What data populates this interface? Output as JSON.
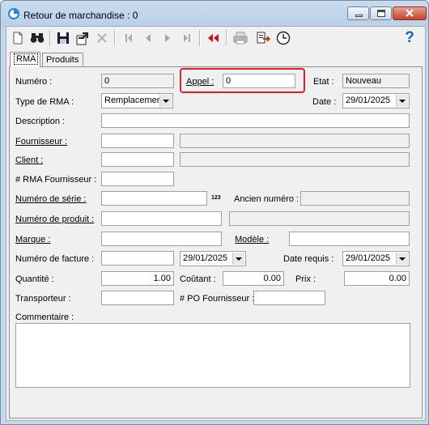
{
  "window": {
    "title": "Retour de marchandise : 0",
    "help_label": "?"
  },
  "toolbar": {
    "icons": [
      "new-document-icon",
      "binoculars-search-icon",
      "save-icon",
      "export-icon",
      "delete-icon",
      "first-record-icon",
      "previous-record-icon",
      "next-record-icon",
      "last-record-icon",
      "rewind-icon",
      "print-icon",
      "transfer-icon",
      "clock-icon"
    ]
  },
  "tabs": [
    "RMA",
    "Produits"
  ],
  "form": {
    "numero_label": "Numéro :",
    "numero_value": "0",
    "appel_label": "Appel :",
    "appel_value": "0",
    "etat_label": "Etat :",
    "etat_value": "Nouveau",
    "type_label": "Type de RMA :",
    "type_value": "Remplacement",
    "date_label": "Date :",
    "date_value": "29/01/2025",
    "description_label": "Description :",
    "fournisseur_label": "Fournisseur :",
    "client_label": "Client :",
    "rma_fournisseur_label": "# RMA Fournisseur :",
    "serie_label": "Numéro de série :",
    "serie_badge": "123",
    "ancien_label": "Ancien numéro :",
    "produit_label": "Numéro de produit :",
    "marque_label": "Marque :",
    "modele_label": "Modèle :",
    "facture_label": "Numéro de facture :",
    "facture_date": "29/01/2025",
    "date_requis_label": "Date requis :",
    "date_requis_value": "29/01/2025",
    "quantite_label": "Quantité :",
    "quantite_value": "1.00",
    "coutant_label": "Coûtant :",
    "coutant_value": "0.00",
    "prix_label": "Prix :",
    "prix_value": "0.00",
    "transporteur_label": "Transporteur :",
    "po_label": "# PO Fournisseur :",
    "commentaire_label": "Commentaire :"
  },
  "colors": {
    "highlight": "#e02020",
    "help": "#1560c0",
    "rewind": "#d01010"
  }
}
